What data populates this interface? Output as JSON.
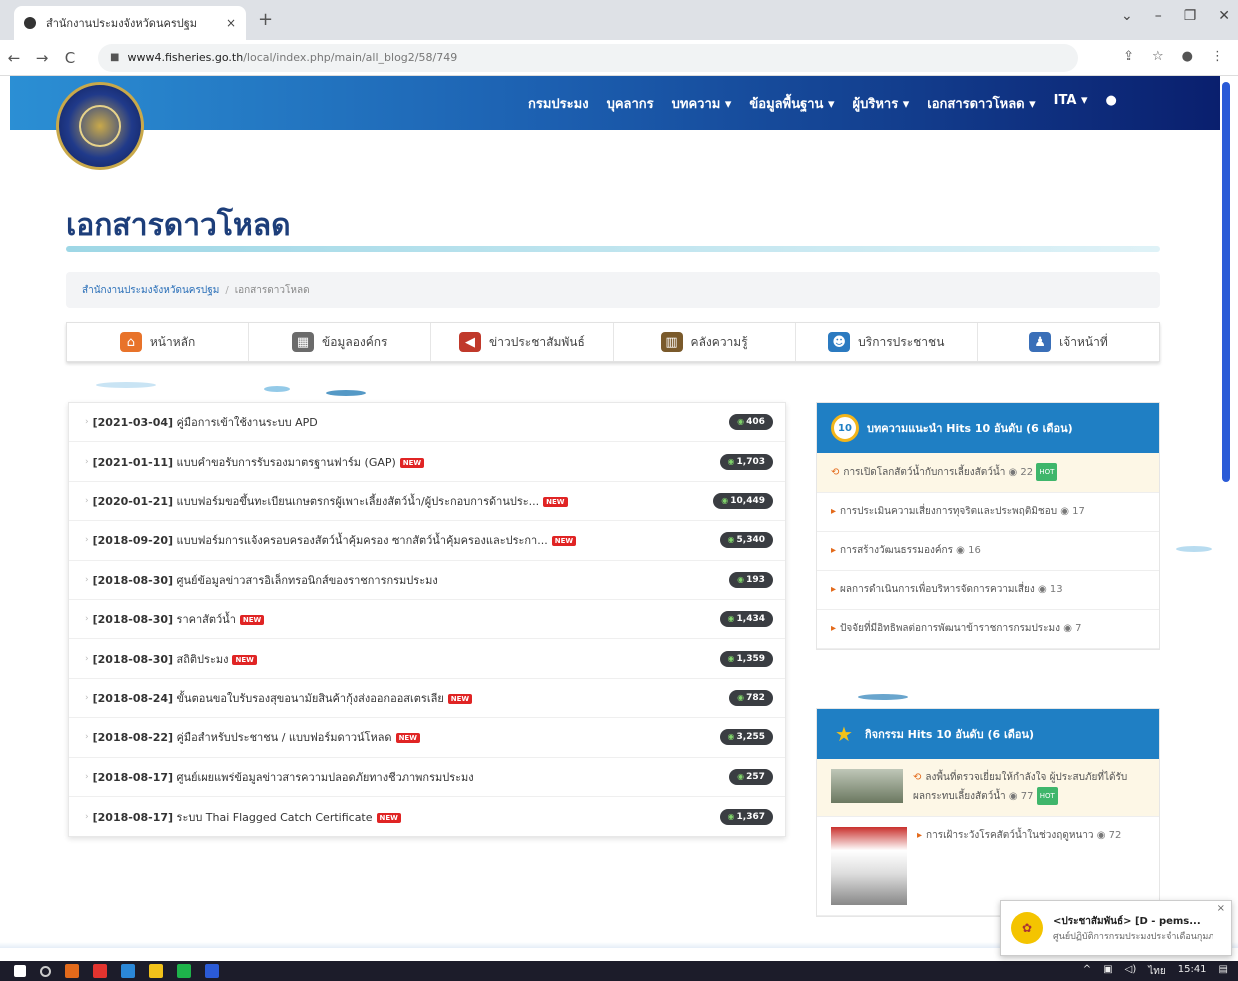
{
  "browser": {
    "tab_title": "สำนักงานประมงจังหวัดนครปฐม",
    "tab_close": "×",
    "new_tab": "+",
    "window_controls": [
      "⌄",
      "–",
      "❐",
      "✕"
    ],
    "url_host": "www4.fisheries.go.th",
    "url_path": "/local/index.php/main/all_blog2/58/749"
  },
  "header": {
    "nav": [
      "กรมประมง",
      "บุคลากร",
      "บทความ ▾",
      "ข้อมูลพื้นฐาน ▾",
      "ผู้บริหาร ▾",
      "เอกสารดาวโหลด ▾",
      "ITA ▾",
      "●"
    ]
  },
  "page_title": "เอกสารดาวโหลด",
  "breadcrumb": {
    "home": "สำนักงานประมงจังหวัดนครปฐม",
    "sep": "/",
    "current": "เอกสารดาวโหลด"
  },
  "main_nav": [
    {
      "label": "หน้าหลัก",
      "icon": "home-icon",
      "color": "#e8732a"
    },
    {
      "label": "ข้อมูลองค์กร",
      "icon": "building-icon",
      "color": "#6b6b6b"
    },
    {
      "label": "ข่าวประชาสัมพันธ์",
      "icon": "megaphone-icon",
      "color": "#c0392b"
    },
    {
      "label": "คลังความรู้",
      "icon": "books-icon",
      "color": "#7a5a2b"
    },
    {
      "label": "บริการประชาชน",
      "icon": "people-icon",
      "color": "#2b7ac0"
    },
    {
      "label": "เจ้าหน้าที่",
      "icon": "user-icon",
      "color": "#3a6fb8"
    }
  ],
  "documents": [
    {
      "date": "[2021-03-04]",
      "title": "คู่มือการเข้าใช้งานระบบ APD",
      "new": false,
      "hits": "406"
    },
    {
      "date": "[2021-01-11]",
      "title": "แบบคำขอรับการรับรองมาตรฐานฟาร์ม (GAP)",
      "new": true,
      "hits": "1,703"
    },
    {
      "date": "[2020-01-21]",
      "title": "แบบฟอร์มขอขึ้นทะเบียนเกษตรกรผู้เพาะเลี้ยงสัตว์น้ำ/ผู้ประกอบการด้านประ...",
      "new": true,
      "hits": "10,449"
    },
    {
      "date": "[2018-09-20]",
      "title": "แบบฟอร์มการแจ้งครอบครองสัตว์น้ำคุ้มครอง ซากสัตว์น้ำคุ้มครองและประกา...",
      "new": true,
      "hits": "5,340"
    },
    {
      "date": "[2018-08-30]",
      "title": "ศูนย์ข้อมูลข่าวสารอิเล็กทรอนิกส์ของราชการกรมประมง",
      "new": false,
      "hits": "193"
    },
    {
      "date": "[2018-08-30]",
      "title": "ราคาสัตว์น้ำ",
      "new": true,
      "hits": "1,434"
    },
    {
      "date": "[2018-08-30]",
      "title": "สถิติประมง",
      "new": true,
      "hits": "1,359"
    },
    {
      "date": "[2018-08-24]",
      "title": "ขั้นตอนขอใบรับรองสุขอนามัยสินค้ากุ้งส่งออกออสเตรเลีย",
      "new": true,
      "hits": "782"
    },
    {
      "date": "[2018-08-22]",
      "title": "คู่มือสำหรับประชาชน / แบบฟอร์มดาวน์โหลด",
      "new": true,
      "hits": "3,255"
    },
    {
      "date": "[2018-08-17]",
      "title": "ศูนย์เผยแพร่ข้อมูลข่าวสารความปลอดภัยทางชีวภาพกรมประมง",
      "new": false,
      "hits": "257"
    },
    {
      "date": "[2018-08-17]",
      "title": "ระบบ Thai Flagged Catch Certificate",
      "new": true,
      "hits": "1,367"
    }
  ],
  "hot_articles": {
    "badge": "10",
    "title": "บทความแนะนำ Hits 10 อันดับ (6 เดือน)",
    "items": [
      {
        "text": "การเปิดโลกสัตว์น้ำกับการเลี้ยงสัตว์น้ำ",
        "count": "22",
        "highlight": true,
        "hot": true
      },
      {
        "text": "การประเมินความเสี่ยงการทุจริตและประพฤติมิชอบ",
        "count": "17",
        "highlight": false,
        "hot": false
      },
      {
        "text": "การสร้างวัฒนธรรมองค์กร",
        "count": "16",
        "highlight": false,
        "hot": false
      },
      {
        "text": "ผลการดำเนินการเพื่อบริหารจัดการความเสี่ยง",
        "count": "13",
        "highlight": false,
        "hot": false
      },
      {
        "text": "ปัจจัยที่มีอิทธิพลต่อการพัฒนาข้าราชการกรมประมง",
        "count": "7",
        "highlight": false,
        "hot": false
      }
    ]
  },
  "hot_activities": {
    "title": "กิจกรรม Hits 10 อันดับ (6 เดือน)",
    "items": [
      {
        "text": "ลงพื้นที่ตรวจเยี่ยมให้กำลังใจ ผู้ประสบภัยที่ได้รับผลกระทบเลี้ยงสัตว์น้ำ",
        "count": "77",
        "hot": true
      },
      {
        "text": "การเฝ้าระวังโรคสัตว์น้ำในช่วงฤดูหนาว",
        "count": "72",
        "hot": false
      }
    ]
  },
  "notification": {
    "title": "<ประชาสัมพันธ์> [D - pems...",
    "body": "ศูนย์ปฏิบัติการกรมประมงประจำเดือนกุมภาพันธ์...",
    "close": "×"
  },
  "taskbar": {
    "tray": [
      "^",
      "ไทย",
      "15:41"
    ]
  }
}
